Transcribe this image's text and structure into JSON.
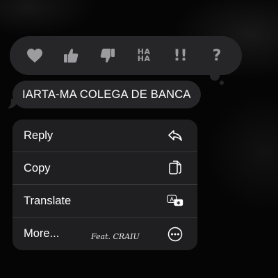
{
  "reactions": {
    "items": [
      {
        "name": "heart",
        "icon": "heart-icon"
      },
      {
        "name": "thumbs-up",
        "icon": "thumbs-up-icon"
      },
      {
        "name": "thumbs-down",
        "icon": "thumbs-down-icon"
      },
      {
        "name": "haha",
        "line1": "HA",
        "line2": "HA"
      },
      {
        "name": "exclamation",
        "label": "!!"
      },
      {
        "name": "question",
        "label": "?"
      }
    ]
  },
  "message": {
    "text": "IARTA-MA COLEGA DE BANCA"
  },
  "menu": {
    "items": [
      {
        "label": "Reply",
        "icon": "reply-arrow-icon"
      },
      {
        "label": "Copy",
        "icon": "copy-icon"
      },
      {
        "label": "Translate",
        "icon": "translate-icon"
      },
      {
        "label": "More...",
        "icon": "more-ellipsis-icon"
      }
    ]
  },
  "watermark": {
    "text": "Feat. CRAIU"
  },
  "colors": {
    "background": "#050505",
    "bubble": "#262628",
    "menu": "#1f1f21",
    "reaction_icon": "#9b9ba0",
    "text": "#ffffff"
  }
}
